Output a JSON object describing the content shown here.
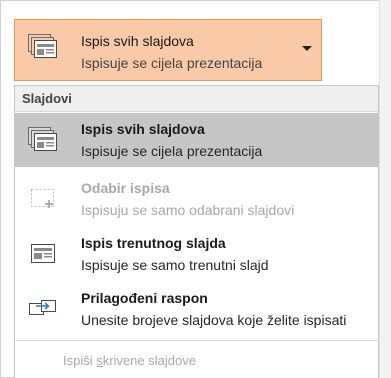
{
  "trigger": {
    "title": "Ispis svih slajdova",
    "subtitle": "Ispisuje se cijela prezentacija",
    "icon": "slides-stack-icon",
    "accent_bg": "#f9c9a8",
    "accent_border": "#e99559"
  },
  "dropdown": {
    "section_header": "Slajdovi",
    "items": [
      {
        "title": "Ispis svih slajdova",
        "description": "Ispisuje se cijela prezentacija",
        "icon": "slides-stack-icon",
        "state": "selected"
      },
      {
        "title": "Odabir ispisa",
        "description": "Ispisuju se samo odabrani slajdovi",
        "icon": "selection-plus-icon",
        "state": "disabled"
      },
      {
        "title": "Ispis trenutnog slajda",
        "description": "Ispisuje se samo trenutni slajd",
        "icon": "single-slide-icon",
        "state": "normal"
      },
      {
        "title": "Prilagođeni raspon",
        "description": "Unesite brojeve slajdova koje želite ispisati",
        "icon": "custom-range-icon",
        "state": "normal"
      }
    ],
    "footer_option_prefix": "Ispiši ",
    "footer_option_underlined": "s",
    "footer_option_suffix": "krivene slajdove"
  }
}
